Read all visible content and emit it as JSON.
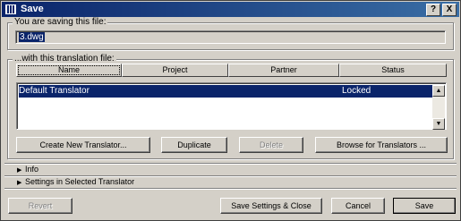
{
  "window": {
    "title": "Save",
    "help_glyph": "?",
    "close_glyph": "X"
  },
  "file_section": {
    "label": "You are saving this file:",
    "value": "3.dwg"
  },
  "translator_section": {
    "label": "...with this translation file:",
    "columns": [
      "Name",
      "Project",
      "Partner",
      "Status"
    ],
    "rows": [
      {
        "name": "Default Translator",
        "status": "Locked"
      }
    ]
  },
  "actions": {
    "create": "Create New Translator...",
    "duplicate": "Duplicate",
    "delete": "Delete",
    "browse": "Browse for Translators ..."
  },
  "expanders": {
    "info": "Info",
    "settings": "Settings in Selected Translator"
  },
  "footer": {
    "revert": "Revert",
    "save_settings_close": "Save Settings & Close",
    "cancel": "Cancel",
    "save": "Save"
  }
}
